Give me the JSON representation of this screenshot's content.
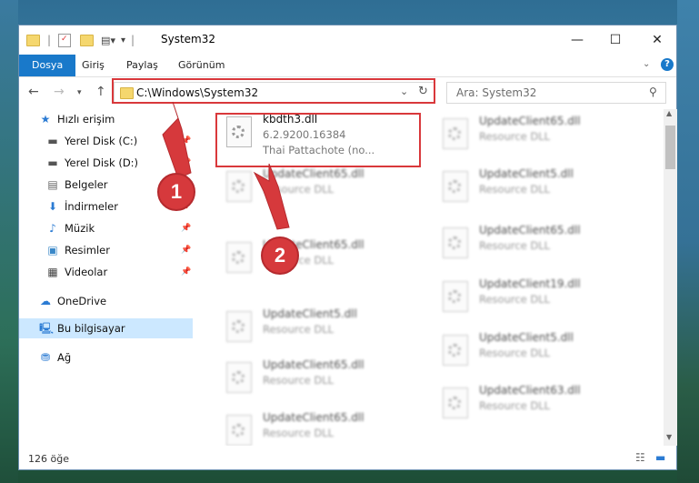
{
  "window": {
    "title": "System32"
  },
  "ribbon": {
    "tabs": [
      "Dosya",
      "Giriş",
      "Paylaş",
      "Görünüm"
    ]
  },
  "address": {
    "path": "C:\\Windows\\System32",
    "search_placeholder": "Ara: System32"
  },
  "sidebar": {
    "items": [
      {
        "label": "Hızlı erişim",
        "icon": "star-icon",
        "pinned": false
      },
      {
        "label": "Yerel Disk (C:)",
        "icon": "drive-icon",
        "pinned": true
      },
      {
        "label": "Yerel Disk (D:)",
        "icon": "drive-icon",
        "pinned": true
      },
      {
        "label": "Belgeler",
        "icon": "documents-icon",
        "pinned": true
      },
      {
        "label": "İndirmeler",
        "icon": "download-icon",
        "pinned": true
      },
      {
        "label": "Müzik",
        "icon": "music-icon",
        "pinned": true
      },
      {
        "label": "Resimler",
        "icon": "pictures-icon",
        "pinned": true
      },
      {
        "label": "Videolar",
        "icon": "videos-icon",
        "pinned": true
      },
      {
        "label": "OneDrive",
        "icon": "cloud-icon",
        "pinned": false
      },
      {
        "label": "Bu bilgisayar",
        "icon": "computer-icon",
        "pinned": false
      },
      {
        "label": "Ağ",
        "icon": "network-icon",
        "pinned": false
      }
    ]
  },
  "files": {
    "selected": {
      "name": "kbdth3.dll",
      "line1": "6.2.9200.16384",
      "line2": "Thai Pattachote (no..."
    },
    "left": [
      {
        "name": "UpdateClient65.dll",
        "line1": "Resource DLL"
      },
      {
        "name": "UpdateClient65.dll",
        "line1": "Resource DLL"
      },
      {
        "name": "UpdateClient5.dll",
        "line1": "Resource DLL"
      },
      {
        "name": "UpdateClient65.dll",
        "line1": "Resource DLL"
      },
      {
        "name": "UpdateClient65.dll",
        "line1": "Resource DLL"
      }
    ],
    "right": [
      {
        "name": "UpdateClient65.dll",
        "line1": "Resource DLL"
      },
      {
        "name": "UpdateClient5.dll",
        "line1": "Resource DLL"
      },
      {
        "name": "UpdateClient65.dll",
        "line1": "Resource DLL"
      },
      {
        "name": "UpdateClient19.dll",
        "line1": "Resource DLL"
      },
      {
        "name": "UpdateClient5.dll",
        "line1": "Resource DLL"
      },
      {
        "name": "UpdateClient63.dll",
        "line1": "Resource DLL"
      }
    ]
  },
  "status": {
    "count": "126 öğe"
  },
  "annotations": {
    "step1": "1",
    "step2": "2",
    "color": "#d6393c"
  }
}
